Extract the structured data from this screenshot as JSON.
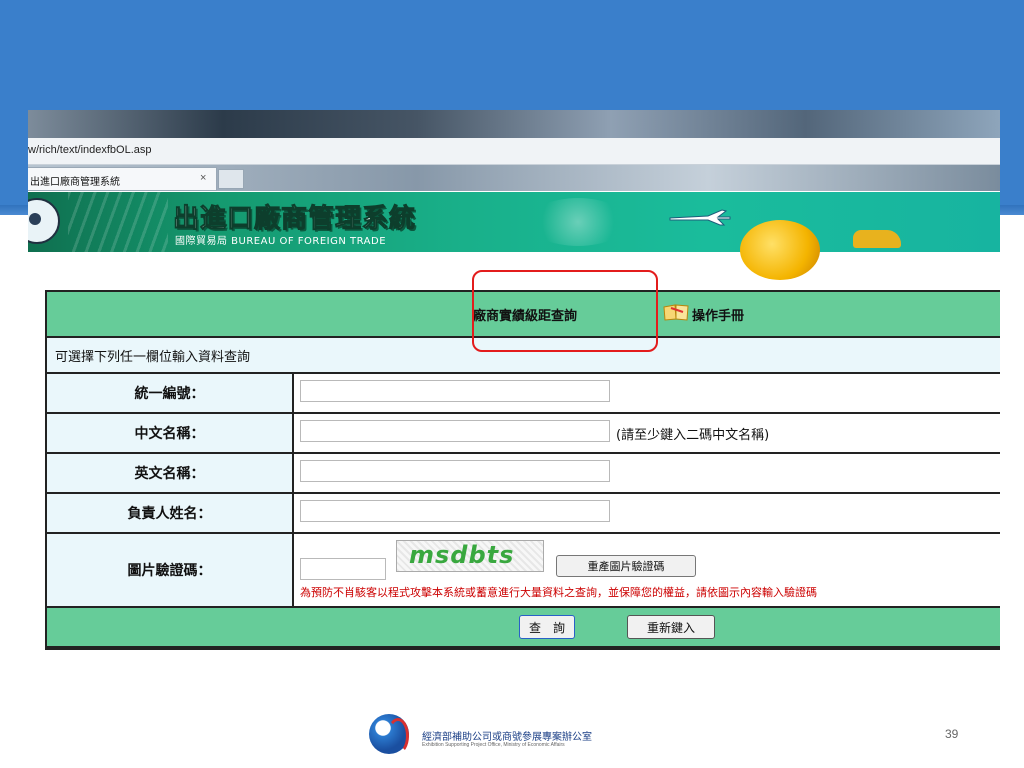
{
  "browser": {
    "url": "w/rich/text/indexfbOL.asp",
    "tab_title": "出進口廠商管理系統",
    "tab_close": "×"
  },
  "site": {
    "title": "出進口廠商管理系統",
    "subtitle": "國際貿易局 BUREAU OF FOREIGN TRADE"
  },
  "form": {
    "header_title": "廠商實績級距查詢",
    "manual_link": "操作手冊",
    "info_text": "可選擇下列任一欄位輸入資料查詢",
    "fields": [
      {
        "label": "統一編號：",
        "value": ""
      },
      {
        "label": "中文名稱：",
        "value": "",
        "hint": "(請至少鍵入二碼中文名稱)"
      },
      {
        "label": "英文名稱：",
        "value": ""
      },
      {
        "label": "負責人姓名：",
        "value": ""
      }
    ],
    "captcha": {
      "label": "圖片驗證碼：",
      "value": "",
      "image_text": "msdbts",
      "refresh_label": "重產圖片驗證碼",
      "warning": "為預防不肖駭客以程式攻擊本系統或蓄意進行大量資料之查詢，並保障您的權益，請依圖示內容輸入驗證碼"
    },
    "submit_label": "查　詢",
    "reset_label": "重新鍵入"
  },
  "footer": {
    "org_name": "經濟部補助公司或商號參展專案辦公室",
    "org_name_en": "Exhibition Supporting Project Office, Ministry of Economic Affairs",
    "page_number": "39"
  },
  "colors": {
    "slide_band": "#3a7fcb",
    "form_header": "#66cc99",
    "highlight": "#e31c1c",
    "warning_text": "#cc0000"
  }
}
